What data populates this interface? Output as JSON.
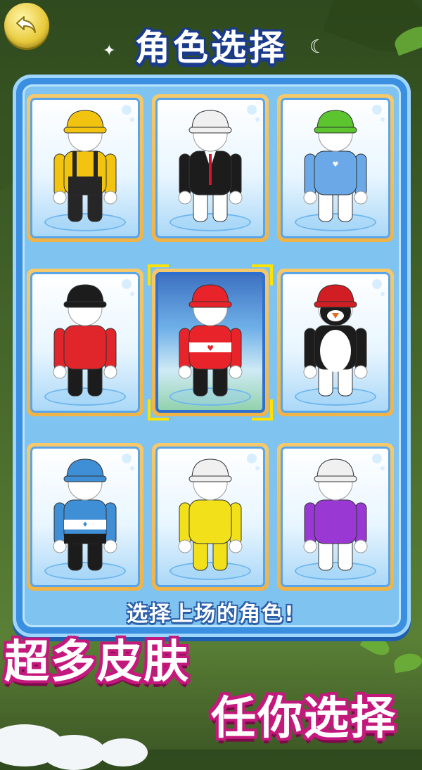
{
  "header": {
    "title": "角色选择",
    "back_icon": "back-arrow-icon"
  },
  "characters": [
    {
      "name": "worker",
      "hat": "#f2c40f",
      "body": "#f2c40f",
      "pants": "#262626",
      "accent": "#262626"
    },
    {
      "name": "suit",
      "hat": "#f0f0f0",
      "body": "#1c1c1c",
      "pants": "#ffffff",
      "accent": "#d8102a"
    },
    {
      "name": "blue-shirt",
      "hat": "#5cc42e",
      "body": "#6aa8e8",
      "pants": "#ffffff",
      "accent": "#ffffff"
    },
    {
      "name": "red-sweater",
      "hat": "#1c1c1c",
      "body": "#e0262b",
      "pants": "#1c1c1c",
      "accent": "#ffffff"
    },
    {
      "name": "hero",
      "hat": "#e8242a",
      "body": "#e8242a",
      "pants": "#1c1c1c",
      "accent": "#ffffff"
    },
    {
      "name": "penguin",
      "hat": "#d11e24",
      "body": "#1c1c1c",
      "pants": "#ffffff",
      "accent": "#e86a1c"
    },
    {
      "name": "striped",
      "hat": "#3f8fd6",
      "body": "#3f8fd6",
      "pants": "#1c1c1c",
      "accent": "#ffffff"
    },
    {
      "name": "yellow-suit",
      "hat": "#f0f0f0",
      "body": "#f2e01a",
      "pants": "#f2e01a",
      "accent": "#3aa0e8"
    },
    {
      "name": "purple-shirt",
      "hat": "#f0f0f0",
      "body": "#9a38d4",
      "pants": "#ffffff",
      "accent": "#ffffff"
    }
  ],
  "selected_index": 4,
  "prompt": "选择上场的角色!",
  "promo": {
    "line1": "超多皮肤",
    "line2": "任你选择"
  }
}
